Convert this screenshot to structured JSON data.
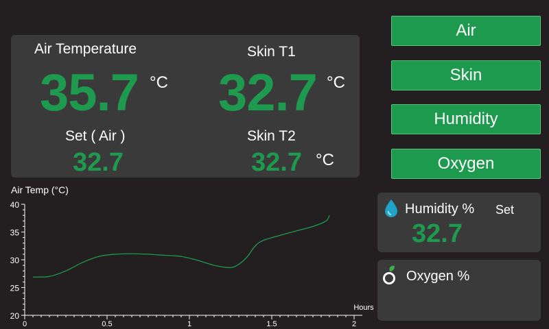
{
  "readings": {
    "air_temperature": {
      "label": "Air Temperature",
      "value": "35.7",
      "unit": "°C"
    },
    "skin_t1": {
      "label": "Skin T1",
      "value": "32.7",
      "unit": "°C"
    },
    "set_air": {
      "label": "Set ( Air )",
      "value": "32.7"
    },
    "skin_t2": {
      "label": "Skin T2",
      "value": "32.7",
      "unit": "°C"
    }
  },
  "nav": {
    "air": "Air",
    "skin": "Skin",
    "humidity": "Humidity",
    "oxygen": "Oxygen"
  },
  "humidity_panel": {
    "label": "Humidity %",
    "set_label": "Set",
    "value": "32.7",
    "icon": "water-drop-icon"
  },
  "oxygen_panel": {
    "label": "Oxygen %",
    "icon": "oxygen-icon"
  },
  "colors": {
    "accent_green": "#1e9a4f",
    "background": "#231f20",
    "panel": "#3a3a3a"
  },
  "chart_data": {
    "type": "line",
    "title": "Air Temp (°C)",
    "xlabel": "Hours",
    "ylabel": "",
    "xlim": [
      0,
      2
    ],
    "ylim": [
      20,
      40
    ],
    "x_ticks": [
      "0",
      "0.5",
      "1",
      "1.5",
      "2"
    ],
    "y_ticks": [
      "20",
      "25",
      "30",
      "35",
      "40"
    ],
    "grid": false,
    "series": [
      {
        "color": "#1e9a4f",
        "x": [
          0.05,
          0.15,
          0.25,
          0.35,
          0.45,
          0.55,
          0.65,
          0.75,
          0.85,
          0.95,
          1.05,
          1.15,
          1.25,
          1.3,
          1.35,
          1.4,
          1.45,
          1.55,
          1.65,
          1.75,
          1.83,
          1.85
        ],
        "y": [
          26.9,
          27.0,
          28.0,
          29.5,
          30.6,
          31.0,
          31.1,
          31.0,
          30.8,
          30.6,
          29.9,
          29.0,
          28.6,
          29.2,
          30.5,
          32.5,
          33.5,
          34.4,
          35.2,
          36.0,
          37.0,
          38.0
        ]
      }
    ]
  }
}
